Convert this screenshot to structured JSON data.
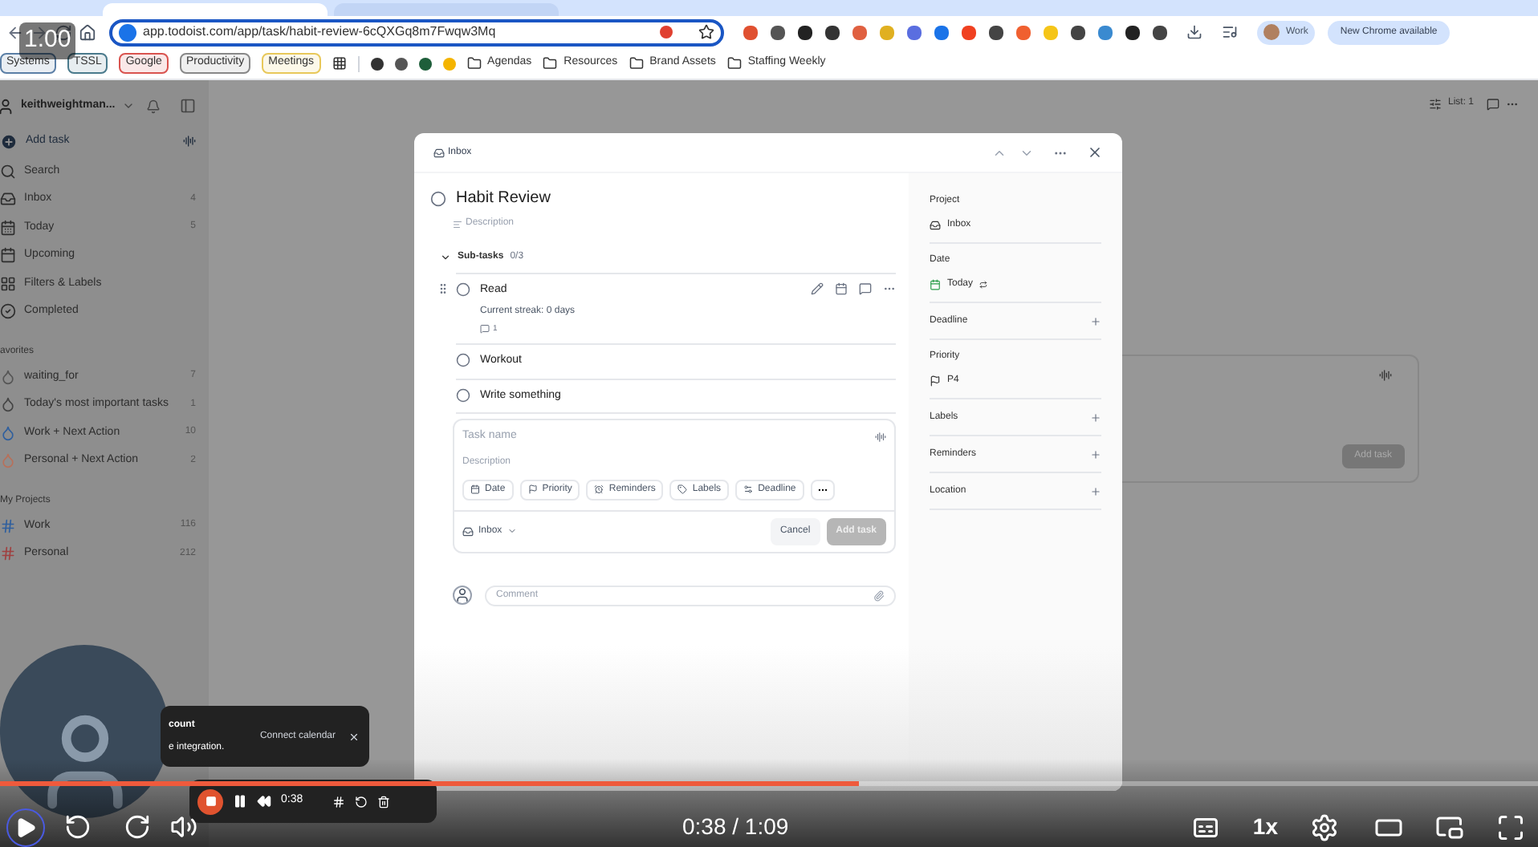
{
  "browser": {
    "address": "app.todoist.com/app/task/habit-review-6cQXGq8m7Fwqw3Mq",
    "profile": "Work",
    "update": "New Chrome available",
    "bookmarks": [
      {
        "label": "Systems",
        "kind": "tag",
        "color": "#5b7fa6"
      },
      {
        "label": "TSSL",
        "kind": "tag",
        "color": "#4a7a8c"
      },
      {
        "label": "Google",
        "kind": "tag",
        "color": "#d9534f"
      },
      {
        "label": "Productivity",
        "kind": "tag",
        "color": "#888888"
      },
      {
        "label": "Meetings",
        "kind": "tag",
        "color": "#e8c85a"
      },
      {
        "label": "Agendas",
        "kind": "folder"
      },
      {
        "label": "Resources",
        "kind": "folder"
      },
      {
        "label": "Brand Assets",
        "kind": "folder"
      },
      {
        "label": "Staffing Weekly",
        "kind": "folder"
      }
    ]
  },
  "speed_overlay": "1.00",
  "sidebar": {
    "user": "keithweightman...",
    "add_task": "Add task",
    "nav": [
      {
        "label": "Search"
      },
      {
        "label": "Inbox",
        "count": "4"
      },
      {
        "label": "Today",
        "count": "5"
      },
      {
        "label": "Upcoming"
      },
      {
        "label": "Filters & Labels"
      },
      {
        "label": "Completed"
      }
    ],
    "favorites_title": "avorites",
    "favorites": [
      {
        "label": "waiting_for",
        "count": "7",
        "color": "#555555"
      },
      {
        "label": "Today's most important tasks",
        "count": "1",
        "color": "#444444"
      },
      {
        "label": "Work + Next Action",
        "count": "10",
        "color": "#2f5f9e"
      },
      {
        "label": "Personal + Next Action",
        "count": "2",
        "color": "#b8705a"
      }
    ],
    "projects_title": "My Projects",
    "projects": [
      {
        "label": "Work",
        "count": "116",
        "color": "#2f5f9e"
      },
      {
        "label": "Personal",
        "count": "212",
        "color": "#a04040"
      }
    ]
  },
  "main": {
    "view": "List: 1",
    "add_task": "Add task"
  },
  "modal": {
    "breadcrumb": "Inbox",
    "title": "Habit Review",
    "completed": false,
    "description_placeholder": "Description",
    "subtasks_label": "Sub-tasks",
    "subtasks_count": "0/3",
    "subtasks": [
      {
        "title": "Read",
        "streak": "Current streak: 0 days",
        "comments": "1",
        "hovered": true,
        "completed": false
      },
      {
        "title": "Workout",
        "hovered": false,
        "completed": false
      },
      {
        "title": "Write something",
        "hovered": false,
        "completed": false
      }
    ],
    "composer": {
      "name_placeholder": "Task name",
      "description_placeholder": "Description",
      "chips": [
        "Date",
        "Priority",
        "Reminders",
        "Labels",
        "Deadline"
      ],
      "project": "Inbox",
      "cancel": "Cancel",
      "submit": "Add task",
      "submit_disabled": true
    },
    "comment_placeholder": "Comment",
    "fields": [
      {
        "label": "Project",
        "kind": "value",
        "value": "Inbox"
      },
      {
        "label": "Date",
        "kind": "value",
        "value": "Today"
      },
      {
        "label": "Deadline",
        "kind": "add"
      },
      {
        "label": "Priority",
        "kind": "value",
        "value": "P4"
      },
      {
        "label": "Labels",
        "kind": "add"
      },
      {
        "label": "Reminders",
        "kind": "add"
      },
      {
        "label": "Location",
        "kind": "add"
      }
    ]
  },
  "toast": {
    "title": "count",
    "text": "e integration.",
    "action": "Connect calendar"
  },
  "recorder": {
    "time": "0:38"
  },
  "video": {
    "playing": false,
    "level": 0.558,
    "time": "0:38 / 1:09",
    "speed": "1x"
  }
}
